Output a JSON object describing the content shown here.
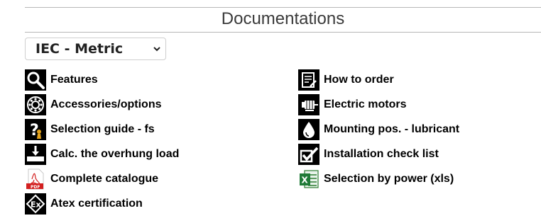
{
  "header": {
    "title": "Documentations"
  },
  "selector": {
    "value": "IEC - Metric"
  },
  "left_items": [
    {
      "label": "Features",
      "icon": "magnifier-icon"
    },
    {
      "label": "Accessories/options",
      "icon": "bearing-icon"
    },
    {
      "label": "Selection guide - fs",
      "icon": "question-guide-icon"
    },
    {
      "label": "Calc. the overhung load",
      "icon": "overhung-load-icon"
    },
    {
      "label": "Complete catalogue",
      "icon": "pdf-icon"
    },
    {
      "label": "Atex certification",
      "icon": "atex-ex-icon"
    }
  ],
  "right_items": [
    {
      "label": "How to order",
      "icon": "order-form-icon"
    },
    {
      "label": "Electric motors",
      "icon": "motor-icon"
    },
    {
      "label": "Mounting pos. - lubricant",
      "icon": "oil-drop-icon"
    },
    {
      "label": "Installation check list",
      "icon": "checklist-icon"
    },
    {
      "label": "Selection by power (xls)",
      "icon": "excel-icon"
    }
  ]
}
